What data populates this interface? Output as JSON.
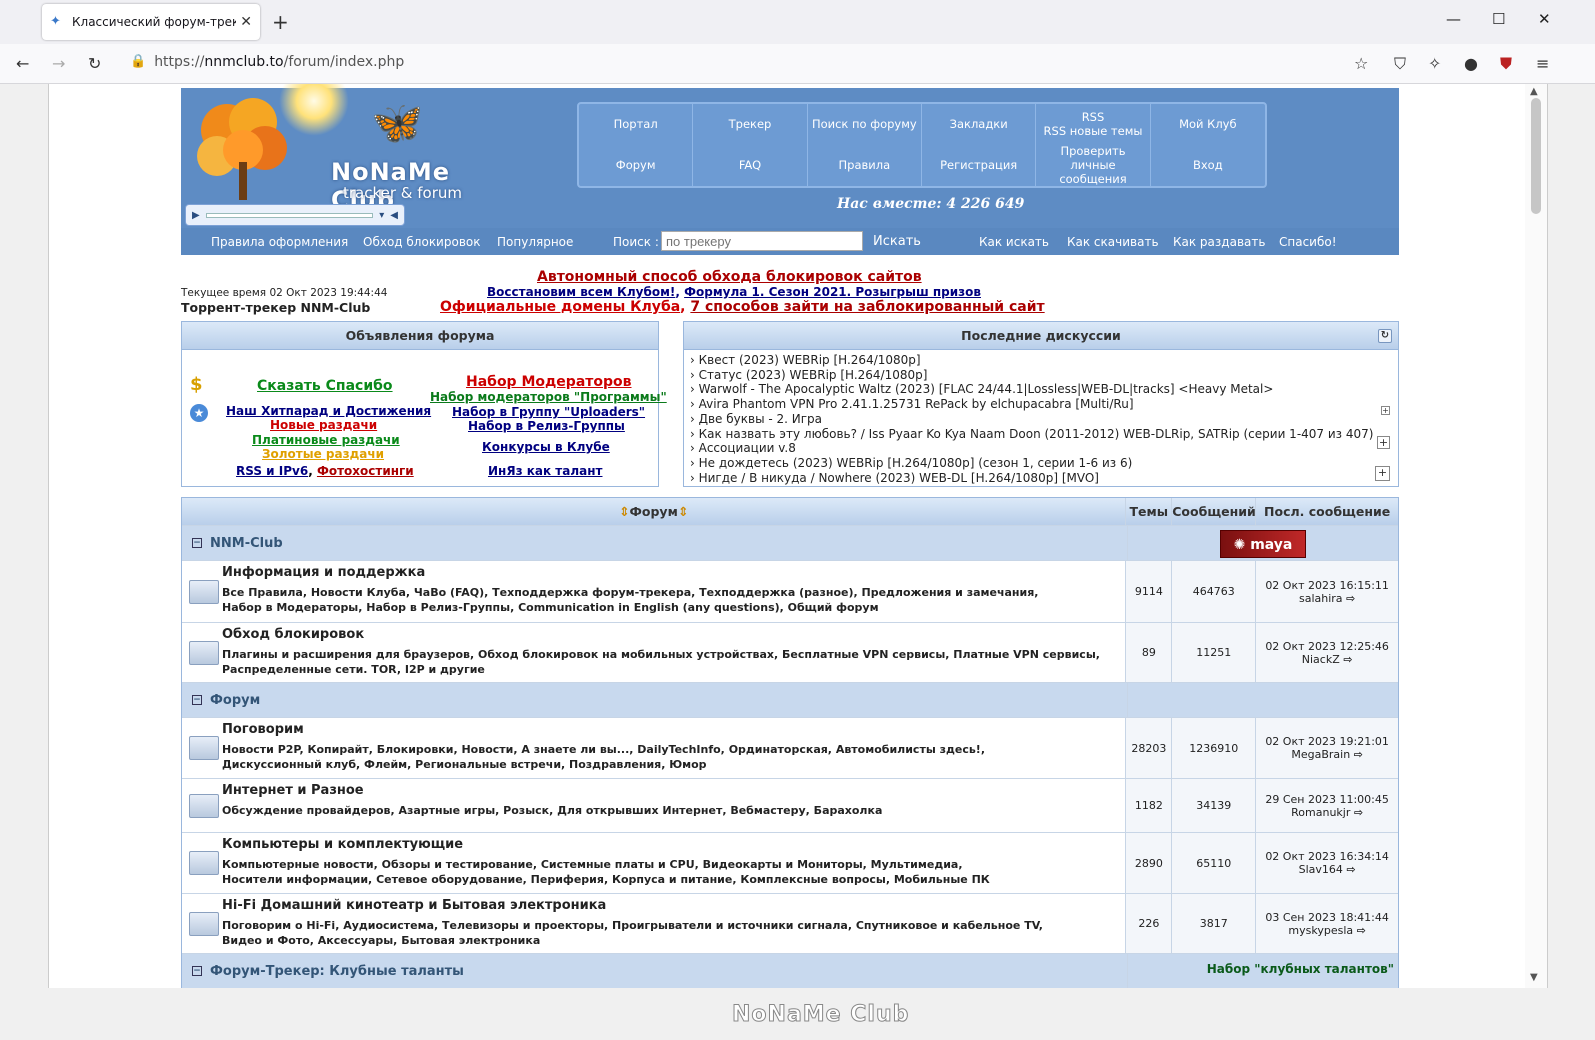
{
  "browser": {
    "tab_title": "Классический форум-трекер",
    "url_prefix": "https://",
    "url_host": "nnmclub.to",
    "url_path": "/forum/index.php"
  },
  "header": {
    "logo_name": "NoNaMe Club",
    "logo_sub": "tracker & forum",
    "together": "Нас вместе: 4 226 649",
    "menu": [
      "Портал",
      "Трекер",
      "Поиск по форуму",
      "Закладки",
      "RSS\nRSS новые темы",
      "Мой Клуб",
      "Форум",
      "FAQ",
      "Правила",
      "Регистрация",
      "Проверить личные\nсообщения",
      "Вход"
    ],
    "links_left": [
      "Правила оформления",
      "Обход блокировок",
      "Популярное"
    ],
    "search_label": "Поиск :",
    "search_placeholder": "по трекеру",
    "search_button": "Искать",
    "links_right": [
      "Как искать",
      "Как скачивать",
      "Как раздавать",
      "Спасибо!"
    ]
  },
  "top": {
    "ann1": "Автономный способ обхода блокировок сайтов",
    "ann2a": "Восстановим всем Клубом!",
    "ann2b": "Формула 1. Сезон 2021. Розыгрыш призов",
    "ann3a": "Официальные домены Клуба",
    "ann3b": "7 способов зайти на заблокированный сайт",
    "current_time": "Текущее время 02 Окт 2023 19:44:44",
    "tracker_name": "Торрент-трекер NNM-Club"
  },
  "ann_box": {
    "title": "Объявления форума",
    "say_thanks": "Сказать Спасибо",
    "hitparade": "Наш Хитпарад и Достижения",
    "new": "Новые раздачи",
    "platinum": "Платиновые раздачи",
    "gold": "Золотые раздачи",
    "rss": "RSS и IPv6",
    "photo": "Фотохостинги",
    "mods": "Набор Модераторов",
    "mods_prog": "Набор модераторов \"Программы\"",
    "uploaders": "Набор в Группу \"Uploaders\"",
    "release": "Набор в Релиз-Группы",
    "contests": "Конкурсы в Клубе",
    "inyaz": "ИнЯз как талант"
  },
  "disc_box": {
    "title": "Последние дискуссии",
    "items": [
      "› Квест (2023) WEBRip [H.264/1080p]",
      "› Статус (2023) WEBRip [H.264/1080p]",
      "› Warwolf - The Apocalyptic Waltz (2023) [FLAC 24/44.1|Lossless|WEB-DL|tracks] <Heavy Metal>",
      "› Avira Phantom VPN Pro 2.41.1.25731 RePack by elchupacabra [Multi/Ru]",
      "› Две буквы - 2. Игра",
      "› Как назвать эту любовь? / Iss Pyaar Ko Kya Naam Doon (2011-2012) WEB-DLRip, SATRip (серии 1-407 из 407)",
      "› Ассоциации v.8",
      "› Не дождетесь (2023) WEBRip [H.264/1080p] (сезон 1, серии 1-6 из 6)",
      "› Нигде / В никуда / Nowhere (2023) WEB-DL [H.264/1080p] [MVO]"
    ]
  },
  "table": {
    "h_forum": "Форум",
    "h_topics": "Темы",
    "h_posts": "Сообщений",
    "h_last": "Посл. сообщение",
    "cat1": "NNM-Club",
    "cat2": "Форум",
    "cat3": "Форум-Трекер: Клубные таланты",
    "cat3_right": "Набор \"клубных талантов\"",
    "forums": [
      {
        "title": "Информация и поддержка",
        "sub1": "Все Правила, Новости Клуба, ЧаВо (FAQ), Техподдержка форум-трекера, Техподдержка (разное), Предложения и замечания,",
        "sub2": "Набор в Модераторы, Набор в Релиз-Группы, Communication in English (any questions), Общий форум",
        "topics": "9114",
        "posts": "464763",
        "date": "02 Окт 2023 16:15:11",
        "user": "salahira"
      },
      {
        "title": "Обход блокировок",
        "sub1": "Плагины и расширения для браузеров, Обход блокировок на мобильных устройствах, Бесплатные VPN сервисы, Платные VPN сервисы,",
        "sub2": "Распределенные сети. TOR, I2P и другие",
        "topics": "89",
        "posts": "11251",
        "date": "02 Окт 2023 12:25:46",
        "user": "NiackZ"
      },
      {
        "title": "Поговорим",
        "sub1": "Новости P2P, Копирайт, Блокировки, Новости, А знаете ли вы..., DailyTechInfo, Ординаторская, Автомобилисты здесь!,",
        "sub2": "Дискуссионный клуб, Флейм, Региональные встречи, Поздравления, Юмор",
        "topics": "28203",
        "posts": "1236910",
        "date": "02 Окт 2023 19:21:01",
        "user": "MegaBrain"
      },
      {
        "title": "Интернет и Разное",
        "sub1": "Обсуждение провайдеров, Азартные игры, Розыск, Для открывших Интернет, Вебмастеру, Барахолка",
        "sub2": "",
        "topics": "1182",
        "posts": "34139",
        "date": "29 Сен 2023 11:00:45",
        "user": "Romanukjr"
      },
      {
        "title": "Компьютеры и комплектующие",
        "sub1": "Компьютерные новости, Обзоры и тестирование, Системные платы и CPU, Видеокарты и Мониторы, Мультимедиа,",
        "sub2": "Носители информации, Сетевое оборудование, Периферия, Корпуса и питание, Комплексные вопросы, Мобильные ПК",
        "topics": "2890",
        "posts": "65110",
        "date": "02 Окт 2023 16:34:14",
        "user": "Slav164"
      },
      {
        "title": "Hi-Fi Домашний кинотеатр и Бытовая электроника",
        "sub1": "Поговорим о Hi-Fi, Аудиосистема, Телевизоры и проекторы, Проигрыватели и источники сигнала, Спутниковое и кабельное TV,",
        "sub2": "Видео и Фото, Аксессуары, Бытовая электроника",
        "topics": "226",
        "posts": "3817",
        "date": "03 Сен 2023 18:41:44",
        "user": "myskypesla"
      }
    ]
  },
  "footer_logo": "NoNaMe Club",
  "colors": {
    "header_blue": "#5e8cc4",
    "link_navy": "#000080",
    "alert_red": "#c00"
  }
}
